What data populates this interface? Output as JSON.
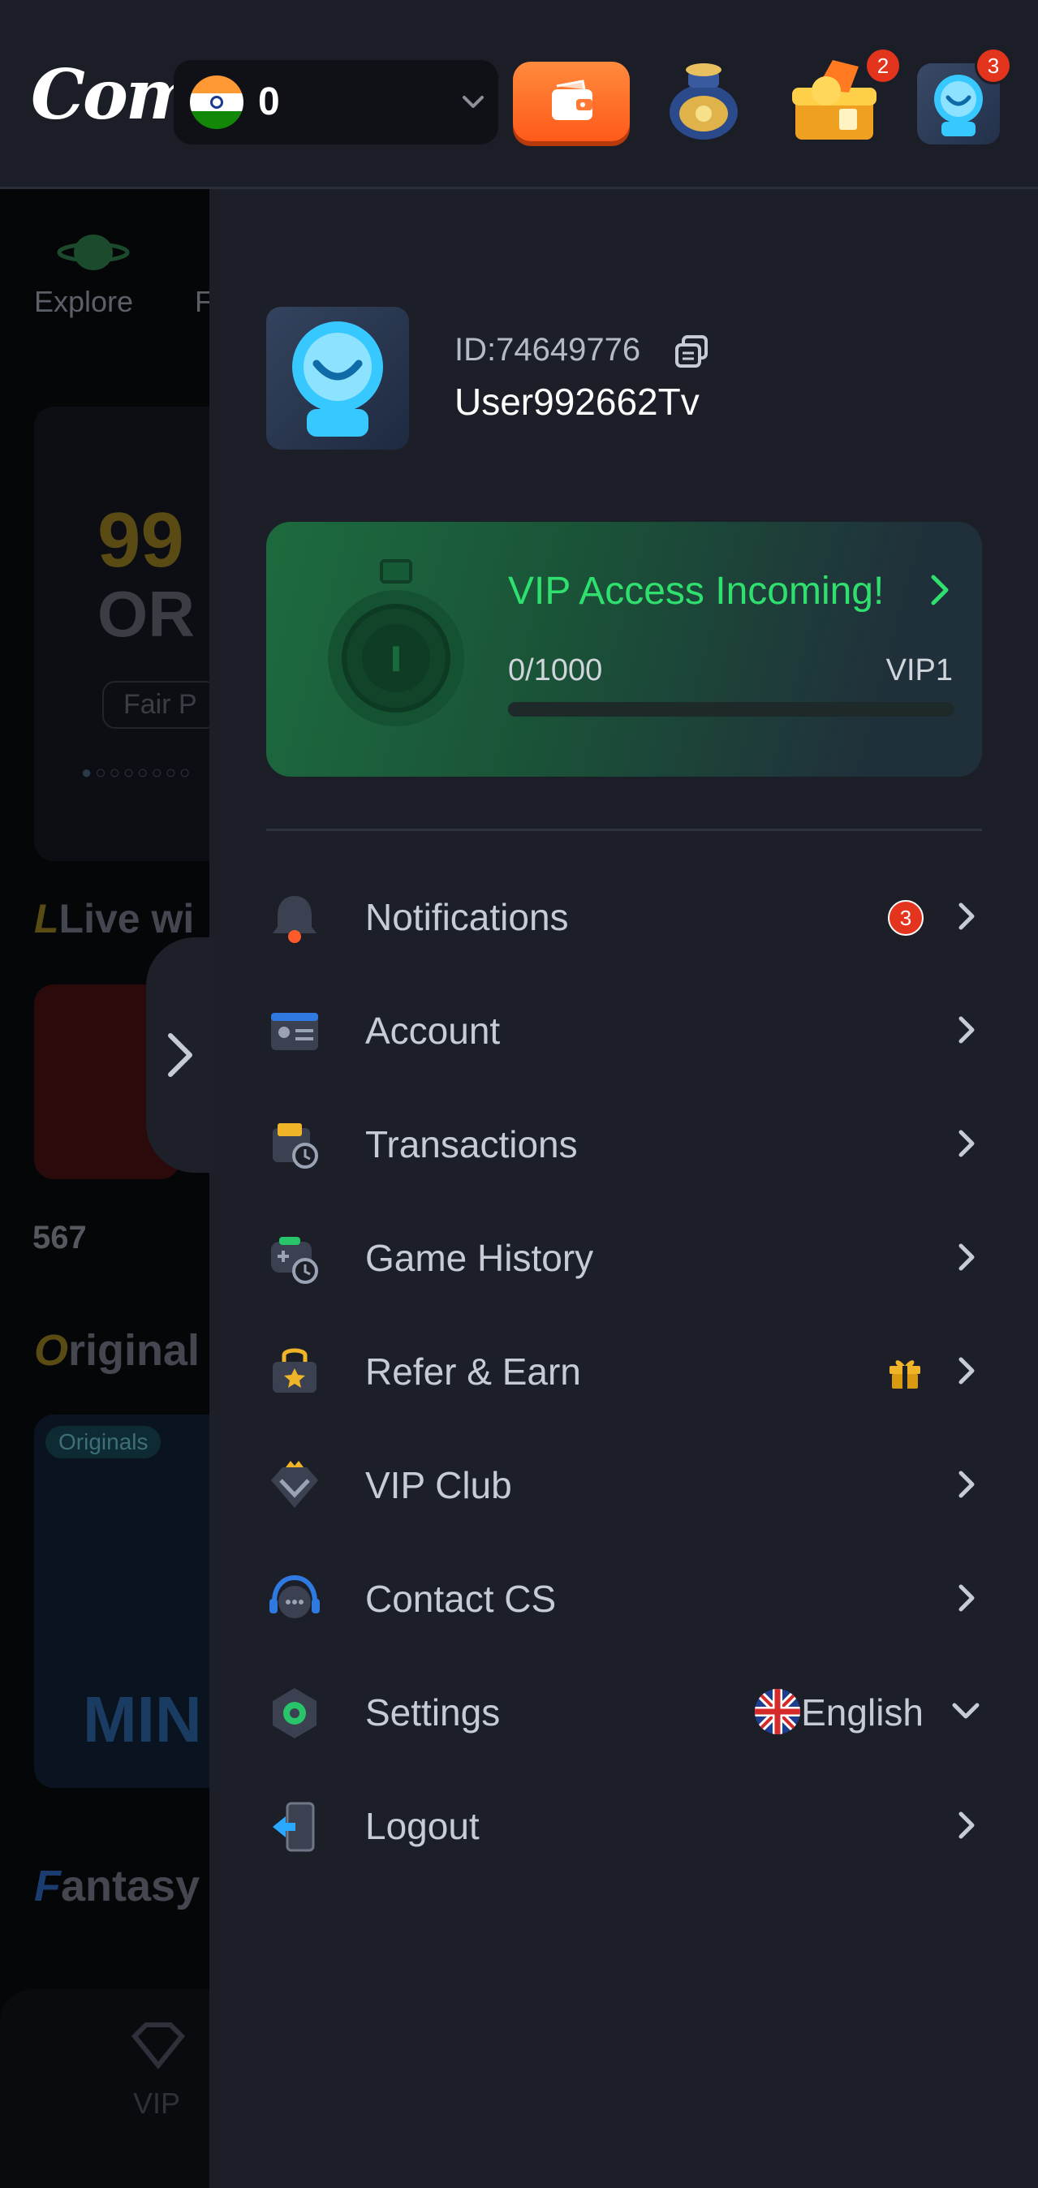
{
  "header": {
    "logo_text": "Come",
    "balance_value": "0",
    "currency_flag": "india-flag-icon",
    "wallet_icon": "wallet-icon",
    "jar_icon": "treasure-jar-icon",
    "chest_icon": "treasure-chest-icon",
    "chest_badge": "2",
    "profile_icon": "profile-avatar-icon",
    "profile_badge": "3"
  },
  "background": {
    "explore_label": "Explore",
    "tab2_label": "F",
    "promo_big_text": "99",
    "promo_sub_text": "OR",
    "promo_pill": "Fair P",
    "live_heading": "Live wi",
    "live_count": "567",
    "originals_heading": "riginal",
    "originals_initial": "O",
    "originals_tag": "Originals",
    "mines_text": "MIN",
    "fantasy_heading": "antasy",
    "fantasy_initial": "F",
    "vip_tab": "VIP"
  },
  "profile": {
    "id_text": "ID:74649776",
    "username": "User992662Tv"
  },
  "vip": {
    "title": "VIP Access Incoming!",
    "progress_text": "0/1000",
    "level": "VIP1",
    "progress_fraction": 0.0
  },
  "menu": {
    "items": [
      {
        "label": "Notifications",
        "icon": "bell-icon",
        "badge": "3"
      },
      {
        "label": "Account",
        "icon": "account-card-icon"
      },
      {
        "label": "Transactions",
        "icon": "transactions-icon"
      },
      {
        "label": "Game History",
        "icon": "game-history-icon"
      },
      {
        "label": "Refer & Earn",
        "icon": "refer-earn-icon"
      },
      {
        "label": "VIP Club",
        "icon": "vip-diamond-icon"
      },
      {
        "label": "Contact CS",
        "icon": "headset-icon"
      },
      {
        "label": "Settings",
        "icon": "settings-icon"
      },
      {
        "label": "Logout",
        "icon": "logout-icon"
      }
    ],
    "language": "English"
  },
  "colors": {
    "accent_green": "#2fe06e",
    "badge_red": "#e3341e",
    "drawer_bg": "#1c1f28",
    "wallet_orange": "#ff6a24"
  }
}
